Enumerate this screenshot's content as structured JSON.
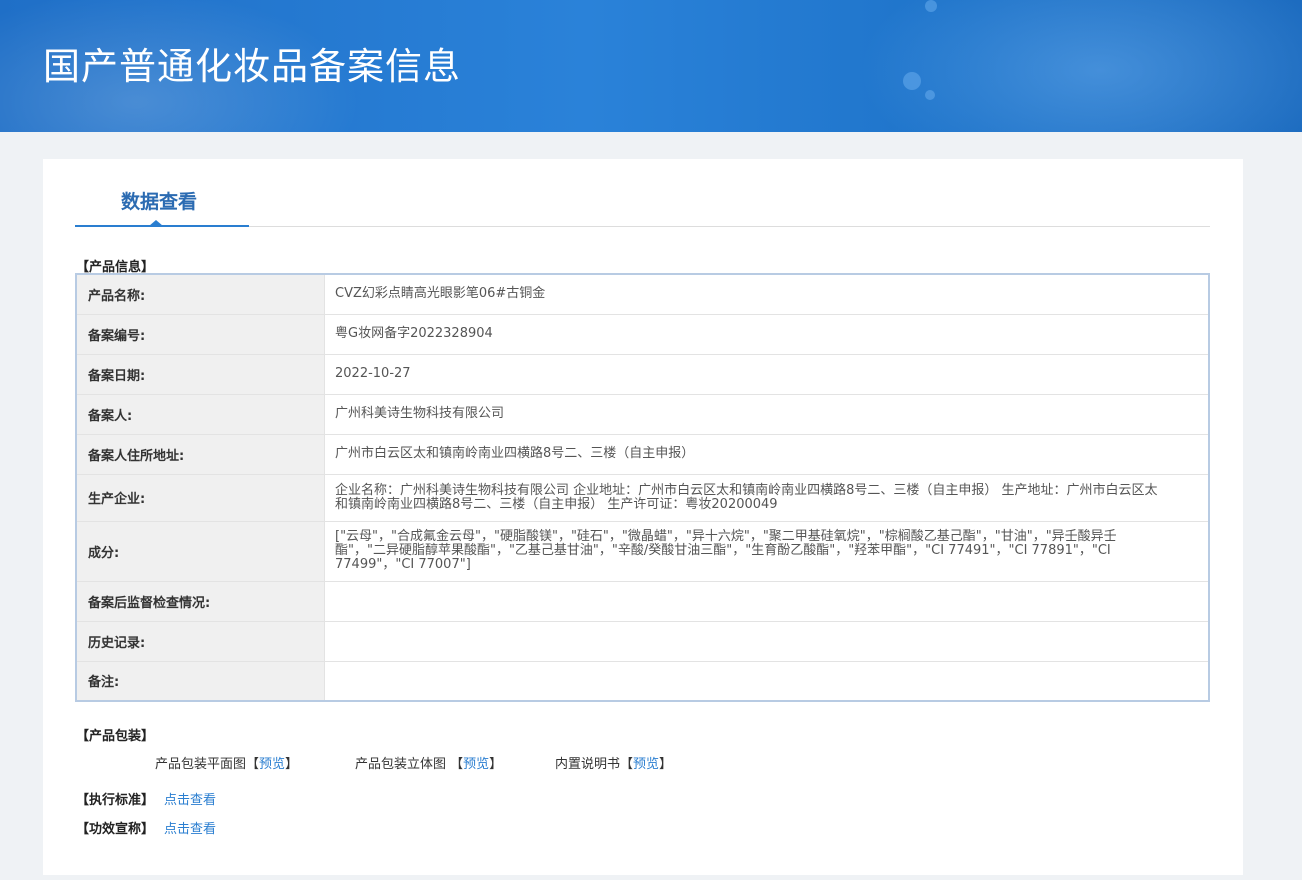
{
  "header": {
    "title": "国产普通化妆品备案信息"
  },
  "tab": {
    "label": "数据查看"
  },
  "product_info": {
    "section_label": "【产品信息】",
    "rows": [
      {
        "key": "产品名称:",
        "value": "CVZ幻彩点睛高光眼影笔06#古铜金"
      },
      {
        "key": "备案编号:",
        "value": "粤G妆网备字2022328904"
      },
      {
        "key": "备案日期:",
        "value": "2022-10-27"
      },
      {
        "key": "备案人:",
        "value": "广州科美诗生物科技有限公司"
      },
      {
        "key": "备案人住所地址:",
        "value": "广州市白云区太和镇南岭南业四横路8号二、三楼（自主申报）"
      },
      {
        "key": "生产企业:",
        "value": "企业名称：广州科美诗生物科技有限公司 企业地址：广州市白云区太和镇南岭南业四横路8号二、三楼（自主申报） 生产地址：广州市白云区太和镇南岭南业四横路8号二、三楼（自主申报） 生产许可证：粤妆20200049"
      },
      {
        "key": "成分:",
        "value": "[\"云母\"，\"合成氟金云母\"，\"硬脂酸镁\"，\"硅石\"，\"微晶蜡\"，\"异十六烷\"，\"聚二甲基硅氧烷\"，\"棕榈酸乙基己酯\"，\"甘油\"，\"异壬酸异壬酯\"，\"二异硬脂醇苹果酸酯\"，\"乙基己基甘油\"，\"辛酸/癸酸甘油三酯\"，\"生育酚乙酸酯\"，\"羟苯甲酯\"，\"CI 77491\"，\"CI 77891\"，\"CI 77499\"，\"CI 77007\"]"
      },
      {
        "key": "备案后监督检查情况:",
        "value": ""
      },
      {
        "key": "历史记录:",
        "value": ""
      },
      {
        "key": "备注:",
        "value": ""
      }
    ]
  },
  "packaging": {
    "section_label": "【产品包装】",
    "items": [
      {
        "label": "产品包装平面图",
        "open": "【",
        "link": "预览",
        "close": "】"
      },
      {
        "label": "产品包装立体图 ",
        "open": "【",
        "link": "预览",
        "close": "】"
      },
      {
        "label": "内置说明书",
        "open": "【",
        "link": "预览",
        "close": "】"
      }
    ]
  },
  "standard": {
    "label": "【执行标准】",
    "link": "点击查看"
  },
  "efficacy": {
    "label": "【功效宣称】",
    "link": "点击查看"
  }
}
